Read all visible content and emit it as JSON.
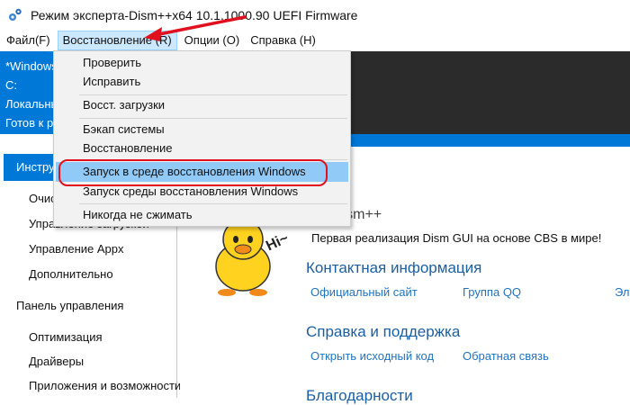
{
  "window": {
    "title": "Режим эксперта-Dism++x64 10.1.1000.90 UEFI Firmware"
  },
  "menubar": {
    "items": [
      "Файл(F)",
      "Восстановление (R)",
      "Опции (O)",
      "Справка (H)"
    ]
  },
  "info": {
    "lines": [
      "*Windows",
      "C:",
      "Локальный",
      "Готов к работе"
    ]
  },
  "dropdown": {
    "items": [
      "Проверить",
      "Исправить",
      "Восст. загрузки",
      "Бэкап системы",
      "Восстановление",
      "Запуск в среде восстановления Windows",
      "Запуск среды восстановления Windows",
      "Никогда не сжимать"
    ]
  },
  "nav": {
    "selected": "Инструменты",
    "tools": [
      "Очистка",
      "Управление загрузкой",
      "Управление Appx",
      "Дополнительно"
    ],
    "section2": "Панель управления",
    "panel": [
      "Оптимизация",
      "Драйверы",
      "Приложения и возможности"
    ]
  },
  "main": {
    "app_name": "Dism++",
    "tagline": "Первая реализация Dism GUI на основе CBS в мире!",
    "mascot_text": "Hi~",
    "contact": {
      "title": "Контактная информация",
      "links": [
        "Официальный сайт",
        "Группа QQ",
        "Эл"
      ]
    },
    "help": {
      "title": "Справка и поддержка",
      "links": [
        "Открыть исходный код",
        "Обратная связь",
        ""
      ]
    },
    "thanks": {
      "title": "Благодарности"
    }
  },
  "colors": {
    "accent": "#0078d7",
    "highlight": "#91c9f7",
    "callout": "#e0101e",
    "link": "#1f73c0"
  }
}
